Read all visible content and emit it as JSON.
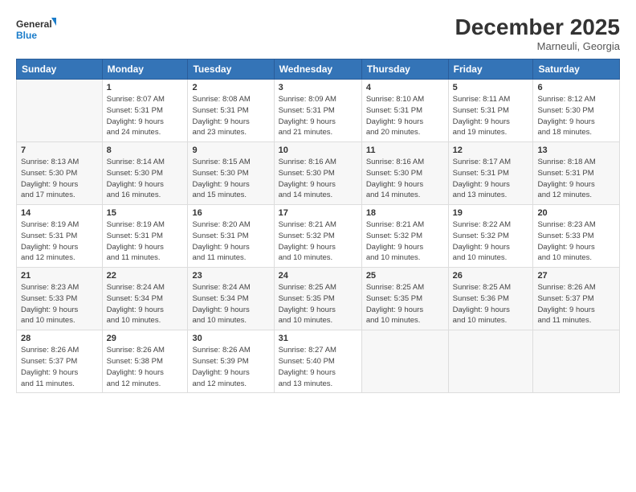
{
  "header": {
    "logo_line1": "General",
    "logo_line2": "Blue",
    "month": "December 2025",
    "location": "Marneuli, Georgia"
  },
  "weekdays": [
    "Sunday",
    "Monday",
    "Tuesday",
    "Wednesday",
    "Thursday",
    "Friday",
    "Saturday"
  ],
  "weeks": [
    [
      {
        "day": "",
        "info": ""
      },
      {
        "day": "1",
        "info": "Sunrise: 8:07 AM\nSunset: 5:31 PM\nDaylight: 9 hours\nand 24 minutes."
      },
      {
        "day": "2",
        "info": "Sunrise: 8:08 AM\nSunset: 5:31 PM\nDaylight: 9 hours\nand 23 minutes."
      },
      {
        "day": "3",
        "info": "Sunrise: 8:09 AM\nSunset: 5:31 PM\nDaylight: 9 hours\nand 21 minutes."
      },
      {
        "day": "4",
        "info": "Sunrise: 8:10 AM\nSunset: 5:31 PM\nDaylight: 9 hours\nand 20 minutes."
      },
      {
        "day": "5",
        "info": "Sunrise: 8:11 AM\nSunset: 5:31 PM\nDaylight: 9 hours\nand 19 minutes."
      },
      {
        "day": "6",
        "info": "Sunrise: 8:12 AM\nSunset: 5:30 PM\nDaylight: 9 hours\nand 18 minutes."
      }
    ],
    [
      {
        "day": "7",
        "info": "Sunrise: 8:13 AM\nSunset: 5:30 PM\nDaylight: 9 hours\nand 17 minutes."
      },
      {
        "day": "8",
        "info": "Sunrise: 8:14 AM\nSunset: 5:30 PM\nDaylight: 9 hours\nand 16 minutes."
      },
      {
        "day": "9",
        "info": "Sunrise: 8:15 AM\nSunset: 5:30 PM\nDaylight: 9 hours\nand 15 minutes."
      },
      {
        "day": "10",
        "info": "Sunrise: 8:16 AM\nSunset: 5:30 PM\nDaylight: 9 hours\nand 14 minutes."
      },
      {
        "day": "11",
        "info": "Sunrise: 8:16 AM\nSunset: 5:30 PM\nDaylight: 9 hours\nand 14 minutes."
      },
      {
        "day": "12",
        "info": "Sunrise: 8:17 AM\nSunset: 5:31 PM\nDaylight: 9 hours\nand 13 minutes."
      },
      {
        "day": "13",
        "info": "Sunrise: 8:18 AM\nSunset: 5:31 PM\nDaylight: 9 hours\nand 12 minutes."
      }
    ],
    [
      {
        "day": "14",
        "info": "Sunrise: 8:19 AM\nSunset: 5:31 PM\nDaylight: 9 hours\nand 12 minutes."
      },
      {
        "day": "15",
        "info": "Sunrise: 8:19 AM\nSunset: 5:31 PM\nDaylight: 9 hours\nand 11 minutes."
      },
      {
        "day": "16",
        "info": "Sunrise: 8:20 AM\nSunset: 5:31 PM\nDaylight: 9 hours\nand 11 minutes."
      },
      {
        "day": "17",
        "info": "Sunrise: 8:21 AM\nSunset: 5:32 PM\nDaylight: 9 hours\nand 10 minutes."
      },
      {
        "day": "18",
        "info": "Sunrise: 8:21 AM\nSunset: 5:32 PM\nDaylight: 9 hours\nand 10 minutes."
      },
      {
        "day": "19",
        "info": "Sunrise: 8:22 AM\nSunset: 5:32 PM\nDaylight: 9 hours\nand 10 minutes."
      },
      {
        "day": "20",
        "info": "Sunrise: 8:23 AM\nSunset: 5:33 PM\nDaylight: 9 hours\nand 10 minutes."
      }
    ],
    [
      {
        "day": "21",
        "info": "Sunrise: 8:23 AM\nSunset: 5:33 PM\nDaylight: 9 hours\nand 10 minutes."
      },
      {
        "day": "22",
        "info": "Sunrise: 8:24 AM\nSunset: 5:34 PM\nDaylight: 9 hours\nand 10 minutes."
      },
      {
        "day": "23",
        "info": "Sunrise: 8:24 AM\nSunset: 5:34 PM\nDaylight: 9 hours\nand 10 minutes."
      },
      {
        "day": "24",
        "info": "Sunrise: 8:25 AM\nSunset: 5:35 PM\nDaylight: 9 hours\nand 10 minutes."
      },
      {
        "day": "25",
        "info": "Sunrise: 8:25 AM\nSunset: 5:35 PM\nDaylight: 9 hours\nand 10 minutes."
      },
      {
        "day": "26",
        "info": "Sunrise: 8:25 AM\nSunset: 5:36 PM\nDaylight: 9 hours\nand 10 minutes."
      },
      {
        "day": "27",
        "info": "Sunrise: 8:26 AM\nSunset: 5:37 PM\nDaylight: 9 hours\nand 11 minutes."
      }
    ],
    [
      {
        "day": "28",
        "info": "Sunrise: 8:26 AM\nSunset: 5:37 PM\nDaylight: 9 hours\nand 11 minutes."
      },
      {
        "day": "29",
        "info": "Sunrise: 8:26 AM\nSunset: 5:38 PM\nDaylight: 9 hours\nand 12 minutes."
      },
      {
        "day": "30",
        "info": "Sunrise: 8:26 AM\nSunset: 5:39 PM\nDaylight: 9 hours\nand 12 minutes."
      },
      {
        "day": "31",
        "info": "Sunrise: 8:27 AM\nSunset: 5:40 PM\nDaylight: 9 hours\nand 13 minutes."
      },
      {
        "day": "",
        "info": ""
      },
      {
        "day": "",
        "info": ""
      },
      {
        "day": "",
        "info": ""
      }
    ]
  ]
}
